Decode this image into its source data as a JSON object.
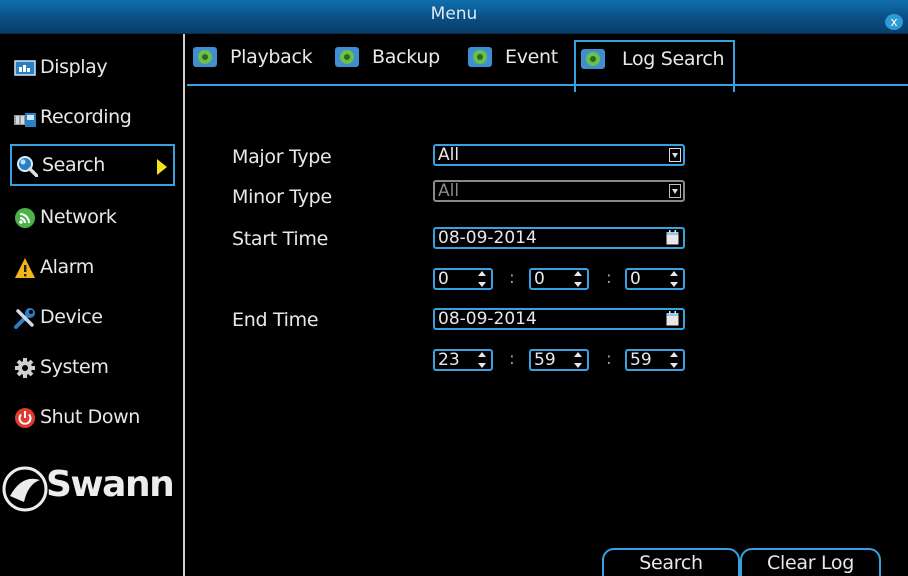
{
  "window": {
    "title": "Menu",
    "close_label": "x"
  },
  "sidebar": {
    "items": [
      {
        "label": "Display",
        "icon": "display-icon"
      },
      {
        "label": "Recording",
        "icon": "recording-icon"
      },
      {
        "label": "Search",
        "icon": "search-icon",
        "active": true
      },
      {
        "label": "Network",
        "icon": "network-icon"
      },
      {
        "label": "Alarm",
        "icon": "alarm-icon"
      },
      {
        "label": "Device",
        "icon": "device-icon"
      },
      {
        "label": "System",
        "icon": "system-icon"
      },
      {
        "label": "Shut Down",
        "icon": "power-icon"
      }
    ],
    "logo_text": "Swann"
  },
  "tabs": [
    {
      "label": "Playback"
    },
    {
      "label": "Backup"
    },
    {
      "label": "Event"
    },
    {
      "label": "Log Search",
      "active": true
    }
  ],
  "form": {
    "major_type": {
      "label": "Major Type",
      "value": "All"
    },
    "minor_type": {
      "label": "Minor Type",
      "value": "All"
    },
    "start_time": {
      "label": "Start Time",
      "date": "08-09-2014",
      "hour": "0",
      "minute": "0",
      "second": "0"
    },
    "end_time": {
      "label": "End Time",
      "date": "08-09-2014",
      "hour": "23",
      "minute": "59",
      "second": "59"
    },
    "separator": ":"
  },
  "buttons": {
    "search": "Search",
    "clear_log": "Clear Log"
  },
  "colors": {
    "accent": "#36a3e0",
    "titlebar": "#0a4f85",
    "arrow": "#f7e11a"
  }
}
